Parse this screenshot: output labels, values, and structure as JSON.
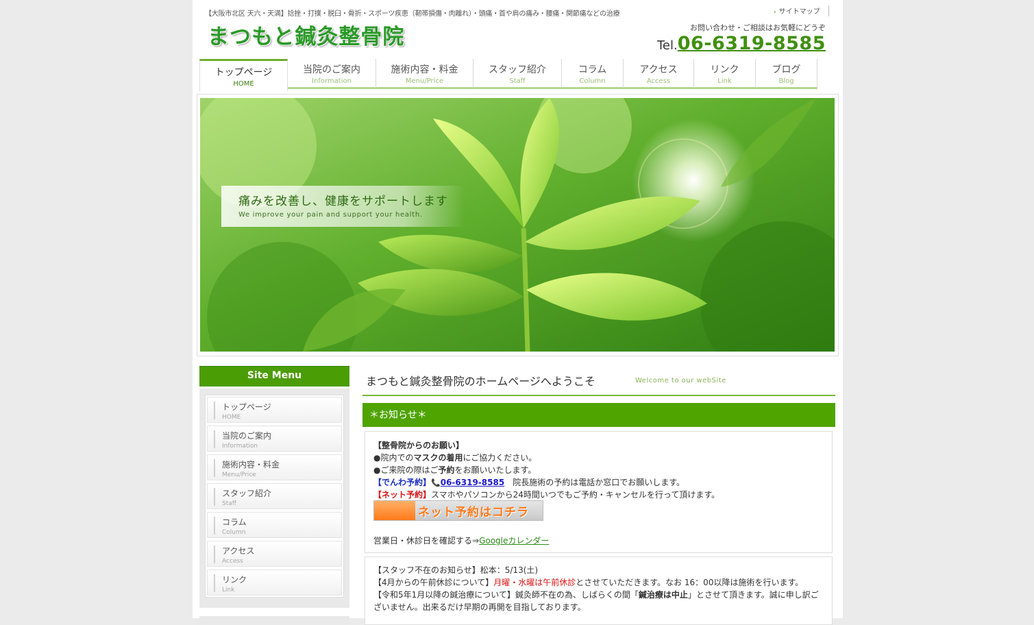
{
  "header": {
    "tagline": "【大阪市北区 天六・天満】捻挫・打撲・脱臼・骨折・スポーツ疾患（靭帯損傷・肉離れ）・頭痛・首や肩の痛み・腰痛・関節痛などの治療",
    "logo": "まつもと鍼灸整骨院",
    "sitemap": "サイトマップ",
    "contact_note": "お問い合わせ・ご相談はお気軽にどうぞ",
    "tel_prefix": "Tel.",
    "tel_number": "06-6319-8585"
  },
  "nav": [
    {
      "jp": "トップページ",
      "en": "HOME"
    },
    {
      "jp": "当院のご案内",
      "en": "Information"
    },
    {
      "jp": "施術内容・料金",
      "en": "Menu/Price"
    },
    {
      "jp": "スタッフ紹介",
      "en": "Staff"
    },
    {
      "jp": "コラム",
      "en": "Column"
    },
    {
      "jp": "アクセス",
      "en": "Access"
    },
    {
      "jp": "リンク",
      "en": "Link"
    },
    {
      "jp": "ブログ",
      "en": "Blog"
    }
  ],
  "hero": {
    "jp": "痛みを改善し、健康をサポートします",
    "en": "We improve your pain and support your health."
  },
  "sidebar": {
    "title": "Site Menu",
    "items": [
      {
        "jp": "トップページ",
        "en": "HOME"
      },
      {
        "jp": "当院のご案内",
        "en": "Information"
      },
      {
        "jp": "施術内容・料金",
        "en": "Menu/Price"
      },
      {
        "jp": "スタッフ紹介",
        "en": "Staff"
      },
      {
        "jp": "コラム",
        "en": "Column"
      },
      {
        "jp": "アクセス",
        "en": "Access"
      },
      {
        "jp": "リンク",
        "en": "Link"
      }
    ]
  },
  "main": {
    "welcome_jp": "まつもと鍼灸整骨院のホームページへようこそ",
    "welcome_en": "Welcome to our webSite",
    "news_title": "＊お知らせ＊",
    "box1": {
      "heading": "【整骨院からのお願い】",
      "mask_pre": "●院内での",
      "mask_bold": "マスクの着用",
      "mask_post": "にご協力ください。",
      "resv_pre": "●ご来院の際はご",
      "resv_bold": "予約",
      "resv_post": "をお願いいたします。",
      "phone_label": "【でんわ予約】",
      "phone_icon": "📞",
      "phone_number": "06-6319-8585",
      "phone_note": "院長施術の予約は電話か窓口でお願いします。",
      "net_label": "【ネット予約】",
      "net_note": "スマホやパソコンから24時間いつでもご予約・キャンセルを行って頂けます。",
      "net_button": "ネット予約はコチラ",
      "calendar_pre": "営業日・休診日を確認する⇒",
      "calendar_link": "Googleカレンダー"
    },
    "box2": {
      "line1": "【スタッフ不在のお知らせ】松本：5/13(土)",
      "line2_pre": "【4月からの午前休診について】",
      "line2_red": "月曜・水曜は午前休診",
      "line2_post": "とさせていただきます。なお 16：00以降は施術を行います。",
      "line3_pre": "【令和5年1月以降の鍼治療について】鍼灸師不在の為、しばらくの間「",
      "line3_bold": "鍼治療は中止",
      "line3_post": "」とさせて頂きます。誠に申し訳ご",
      "line4": "ざいません。出来るだけ早期の再開を目指しております。"
    }
  },
  "colors": {
    "brand_green": "#4fa400",
    "logo_green": "#2a9a27",
    "alert_red": "#d81313",
    "link_blue": "#1a1acc"
  }
}
